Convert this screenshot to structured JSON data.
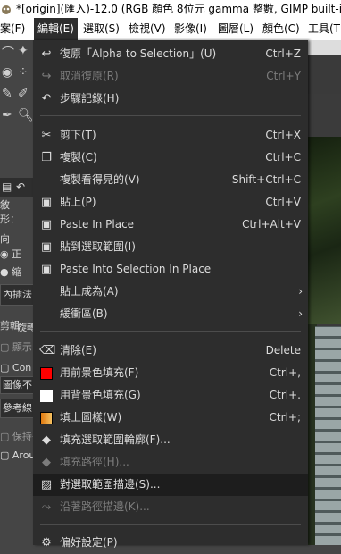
{
  "window": {
    "title": "*[origin](匯入)-12.0 (RGB 顏色 8位元 gamma 整數, GIMP built-in sR"
  },
  "menubar": {
    "items": [
      "案(F)",
      "編輯(E)",
      "選取(S)",
      "檢視(V)",
      "影像(I)",
      "圖層(L)",
      "顏色(C)",
      "工具(T)"
    ],
    "active": "編輯(E)"
  },
  "toolbox": {
    "labels": {
      "l1": "敘",
      "l2": "形：",
      "l3": "向",
      "l4": "正",
      "l5": "縮",
      "l6": "內插法",
      "l7": "剪輯",
      "l8": "旋轉",
      "l9": "顯示",
      "l10": "Con",
      "l11": "圖像不",
      "l12": "參考線",
      "l13": "保持長",
      "l14": "Aroun"
    }
  },
  "menu": {
    "items": [
      {
        "label": "復原「Alpha to Selection」(U)",
        "shortcut": "Ctrl+Z",
        "icon": "undo-icon",
        "enabled": true
      },
      {
        "label": "取消復原(R)",
        "shortcut": "Ctrl+Y",
        "icon": "redo-icon",
        "enabled": false
      },
      {
        "label": "步驟記錄(H)",
        "shortcut": "",
        "icon": "history-icon",
        "enabled": true
      },
      {
        "label": "剪下(T)",
        "shortcut": "Ctrl+X",
        "icon": "scissors-icon",
        "enabled": true
      },
      {
        "label": "複製(C)",
        "shortcut": "Ctrl+C",
        "icon": "copy-icon",
        "enabled": true
      },
      {
        "label": "複製看得見的(V)",
        "shortcut": "Shift+Ctrl+C",
        "icon": "",
        "enabled": true
      },
      {
        "label": "貼上(P)",
        "shortcut": "Ctrl+V",
        "icon": "paste-icon",
        "enabled": true
      },
      {
        "label": "Paste In Place",
        "shortcut": "Ctrl+Alt+V",
        "icon": "paste-in-place-icon",
        "enabled": true
      },
      {
        "label": "貼到選取範圍(I)",
        "shortcut": "",
        "icon": "paste-into-icon",
        "enabled": true
      },
      {
        "label": "Paste Into Selection In Place",
        "shortcut": "",
        "icon": "paste-into-place-icon",
        "enabled": true
      },
      {
        "label": "貼上成為(A)",
        "shortcut": "",
        "icon": "",
        "enabled": true,
        "submenu": true
      },
      {
        "label": "緩衝區(B)",
        "shortcut": "",
        "icon": "",
        "enabled": true,
        "submenu": true
      },
      {
        "label": "清除(E)",
        "shortcut": "Delete",
        "icon": "clear-icon",
        "enabled": true
      },
      {
        "label": "用前景色填充(F)",
        "shortcut": "Ctrl+,",
        "icon": "fg-color-swatch-icon",
        "enabled": true
      },
      {
        "label": "用背景色填充(G)",
        "shortcut": "Ctrl+.",
        "icon": "bg-color-swatch-icon",
        "enabled": true
      },
      {
        "label": "填上圖樣(W)",
        "shortcut": "Ctrl+;",
        "icon": "pattern-swatch-icon",
        "enabled": true
      },
      {
        "label": "填充選取範圍輪廓(F)...",
        "shortcut": "",
        "icon": "fill-selection-icon",
        "enabled": true
      },
      {
        "label": "填充路徑(H)...",
        "shortcut": "",
        "icon": "fill-path-icon",
        "enabled": false
      },
      {
        "label": "對選取範圍描邊(S)...",
        "shortcut": "",
        "icon": "stroke-selection-icon",
        "enabled": true,
        "hover": true
      },
      {
        "label": "沿著路徑描邊(K)...",
        "shortcut": "",
        "icon": "stroke-path-icon",
        "enabled": false
      },
      {
        "label": "偏好設定(P)",
        "shortcut": "",
        "icon": "preferences-icon",
        "enabled": true
      }
    ]
  },
  "colors": {
    "menu_bg": "#2d2d2d",
    "menu_text": "#dcdcdc",
    "disabled_text": "#7c7c7c",
    "hover_bg": "#1d1d1d",
    "fg_swatch": "#ff0000",
    "bg_swatch": "#ffffff",
    "pattern_swatch": "#f0a030"
  }
}
